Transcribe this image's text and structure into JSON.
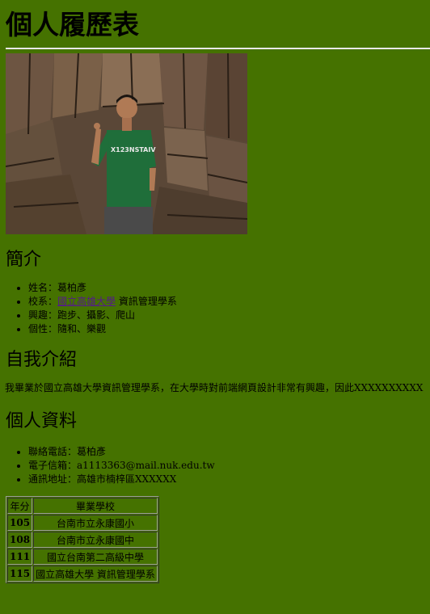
{
  "title": "個人履歷表",
  "photo": {
    "alt": "Profile photo: person in green T-shirt giving a peace sign in front of a rock cliff",
    "shirt_text": "X123NSTAIV"
  },
  "intro_section": {
    "heading": "簡介",
    "items": [
      {
        "label": "姓名：",
        "value": "葛柏彥"
      },
      {
        "label": "校系：",
        "link": "國立高雄大學",
        "value": " 資訊管理學系"
      },
      {
        "label": "興趣：",
        "value": "跑步、攝影、爬山"
      },
      {
        "label": "個性：",
        "value": "隨和、樂觀"
      }
    ]
  },
  "self_intro": {
    "heading": "自我介紹",
    "text": "我畢業於國立高雄大學資訊管理學系，在大學時對前端網頁設計非常有興趣，因此XXXXXXXXXX"
  },
  "personal": {
    "heading": "個人資料",
    "items": [
      {
        "label": "聯絡電話：",
        "value": "葛柏彥"
      },
      {
        "label": "電子信箱：",
        "value": "a1113363@mail.nuk.edu.tw"
      },
      {
        "label": "通訊地址：",
        "value": "高雄市楠梓區XXXXXX"
      }
    ]
  },
  "education_table": {
    "headers": [
      "年分",
      "畢業學校"
    ],
    "rows": [
      [
        "105",
        "台南市立永康國小"
      ],
      [
        "108",
        "台南市立永康國中"
      ],
      [
        "111",
        "國立台南第二高級中學"
      ],
      [
        "115",
        "國立高雄大學 資訊管理學系"
      ]
    ]
  },
  "colors": {
    "background": "#457200",
    "link": "#551a8b",
    "shirt": "#1f6e3a"
  }
}
